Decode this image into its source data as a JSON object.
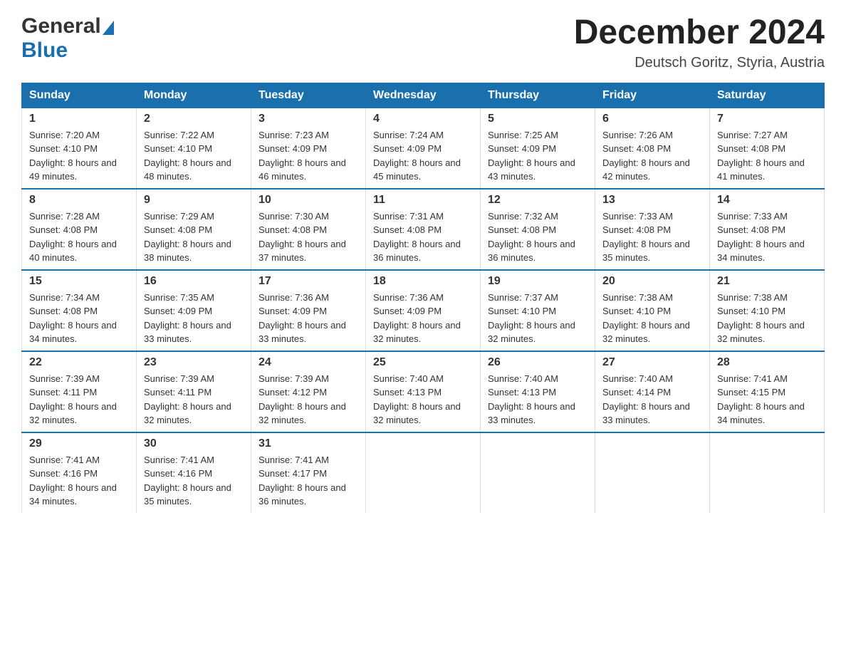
{
  "header": {
    "logo_general": "General",
    "logo_blue": "Blue",
    "month_title": "December 2024",
    "location": "Deutsch Goritz, Styria, Austria"
  },
  "days_of_week": [
    "Sunday",
    "Monday",
    "Tuesday",
    "Wednesday",
    "Thursday",
    "Friday",
    "Saturday"
  ],
  "weeks": [
    [
      {
        "date": "1",
        "sunrise": "7:20 AM",
        "sunset": "4:10 PM",
        "daylight": "8 hours and 49 minutes."
      },
      {
        "date": "2",
        "sunrise": "7:22 AM",
        "sunset": "4:10 PM",
        "daylight": "8 hours and 48 minutes."
      },
      {
        "date": "3",
        "sunrise": "7:23 AM",
        "sunset": "4:09 PM",
        "daylight": "8 hours and 46 minutes."
      },
      {
        "date": "4",
        "sunrise": "7:24 AM",
        "sunset": "4:09 PM",
        "daylight": "8 hours and 45 minutes."
      },
      {
        "date": "5",
        "sunrise": "7:25 AM",
        "sunset": "4:09 PM",
        "daylight": "8 hours and 43 minutes."
      },
      {
        "date": "6",
        "sunrise": "7:26 AM",
        "sunset": "4:08 PM",
        "daylight": "8 hours and 42 minutes."
      },
      {
        "date": "7",
        "sunrise": "7:27 AM",
        "sunset": "4:08 PM",
        "daylight": "8 hours and 41 minutes."
      }
    ],
    [
      {
        "date": "8",
        "sunrise": "7:28 AM",
        "sunset": "4:08 PM",
        "daylight": "8 hours and 40 minutes."
      },
      {
        "date": "9",
        "sunrise": "7:29 AM",
        "sunset": "4:08 PM",
        "daylight": "8 hours and 38 minutes."
      },
      {
        "date": "10",
        "sunrise": "7:30 AM",
        "sunset": "4:08 PM",
        "daylight": "8 hours and 37 minutes."
      },
      {
        "date": "11",
        "sunrise": "7:31 AM",
        "sunset": "4:08 PM",
        "daylight": "8 hours and 36 minutes."
      },
      {
        "date": "12",
        "sunrise": "7:32 AM",
        "sunset": "4:08 PM",
        "daylight": "8 hours and 36 minutes."
      },
      {
        "date": "13",
        "sunrise": "7:33 AM",
        "sunset": "4:08 PM",
        "daylight": "8 hours and 35 minutes."
      },
      {
        "date": "14",
        "sunrise": "7:33 AM",
        "sunset": "4:08 PM",
        "daylight": "8 hours and 34 minutes."
      }
    ],
    [
      {
        "date": "15",
        "sunrise": "7:34 AM",
        "sunset": "4:08 PM",
        "daylight": "8 hours and 34 minutes."
      },
      {
        "date": "16",
        "sunrise": "7:35 AM",
        "sunset": "4:09 PM",
        "daylight": "8 hours and 33 minutes."
      },
      {
        "date": "17",
        "sunrise": "7:36 AM",
        "sunset": "4:09 PM",
        "daylight": "8 hours and 33 minutes."
      },
      {
        "date": "18",
        "sunrise": "7:36 AM",
        "sunset": "4:09 PM",
        "daylight": "8 hours and 32 minutes."
      },
      {
        "date": "19",
        "sunrise": "7:37 AM",
        "sunset": "4:10 PM",
        "daylight": "8 hours and 32 minutes."
      },
      {
        "date": "20",
        "sunrise": "7:38 AM",
        "sunset": "4:10 PM",
        "daylight": "8 hours and 32 minutes."
      },
      {
        "date": "21",
        "sunrise": "7:38 AM",
        "sunset": "4:10 PM",
        "daylight": "8 hours and 32 minutes."
      }
    ],
    [
      {
        "date": "22",
        "sunrise": "7:39 AM",
        "sunset": "4:11 PM",
        "daylight": "8 hours and 32 minutes."
      },
      {
        "date": "23",
        "sunrise": "7:39 AM",
        "sunset": "4:11 PM",
        "daylight": "8 hours and 32 minutes."
      },
      {
        "date": "24",
        "sunrise": "7:39 AM",
        "sunset": "4:12 PM",
        "daylight": "8 hours and 32 minutes."
      },
      {
        "date": "25",
        "sunrise": "7:40 AM",
        "sunset": "4:13 PM",
        "daylight": "8 hours and 32 minutes."
      },
      {
        "date": "26",
        "sunrise": "7:40 AM",
        "sunset": "4:13 PM",
        "daylight": "8 hours and 33 minutes."
      },
      {
        "date": "27",
        "sunrise": "7:40 AM",
        "sunset": "4:14 PM",
        "daylight": "8 hours and 33 minutes."
      },
      {
        "date": "28",
        "sunrise": "7:41 AM",
        "sunset": "4:15 PM",
        "daylight": "8 hours and 34 minutes."
      }
    ],
    [
      {
        "date": "29",
        "sunrise": "7:41 AM",
        "sunset": "4:16 PM",
        "daylight": "8 hours and 34 minutes."
      },
      {
        "date": "30",
        "sunrise": "7:41 AM",
        "sunset": "4:16 PM",
        "daylight": "8 hours and 35 minutes."
      },
      {
        "date": "31",
        "sunrise": "7:41 AM",
        "sunset": "4:17 PM",
        "daylight": "8 hours and 36 minutes."
      },
      null,
      null,
      null,
      null
    ]
  ]
}
